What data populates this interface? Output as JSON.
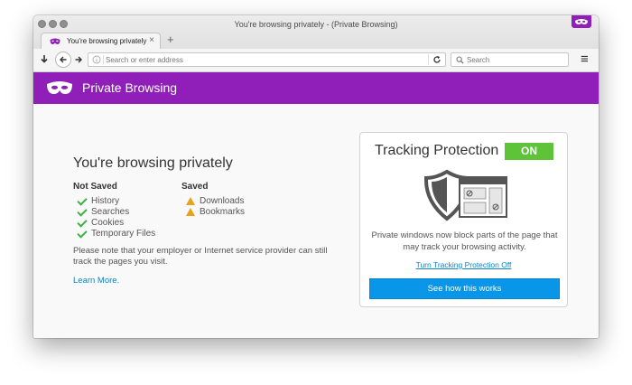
{
  "window": {
    "title": "You're browsing privately - (Private Browsing)"
  },
  "tab": {
    "label": "You're browsing privately",
    "close_glyph": "×",
    "new_tab_glyph": "+"
  },
  "navbar": {
    "url_placeholder": "Search or enter address",
    "search_placeholder": "Search",
    "menu_glyph": "≡"
  },
  "private_bar": {
    "title": "Private Browsing"
  },
  "main": {
    "heading": "You're browsing privately",
    "not_saved": {
      "title": "Not Saved",
      "items": [
        "History",
        "Searches",
        "Cookies",
        "Temporary Files"
      ]
    },
    "saved": {
      "title": "Saved",
      "items": [
        "Downloads",
        "Bookmarks"
      ]
    },
    "note": "Please note that your employer or Internet service provider can still track the pages you visit.",
    "learn_more": "Learn More."
  },
  "tracking": {
    "title": "Tracking Protection",
    "status": "ON",
    "description": "Private windows now block parts of the page that may track your browsing activity.",
    "turn_off_link": "Turn Tracking Protection Off",
    "button": "See how this works"
  },
  "colors": {
    "private_purple": "#8f1fb8",
    "on_green": "#5fc33a",
    "link_blue": "#0a84c8",
    "button_blue": "#0996e8",
    "check_green": "#3fb143",
    "warning_orange": "#e8a21a"
  },
  "icons": [
    "mask-icon",
    "back-icon",
    "forward-icon",
    "download-icon",
    "info-icon",
    "reload-icon",
    "search-icon",
    "hamburger-menu-icon",
    "check-icon",
    "warning-icon",
    "shield-icon",
    "blocked-page-icon"
  ]
}
